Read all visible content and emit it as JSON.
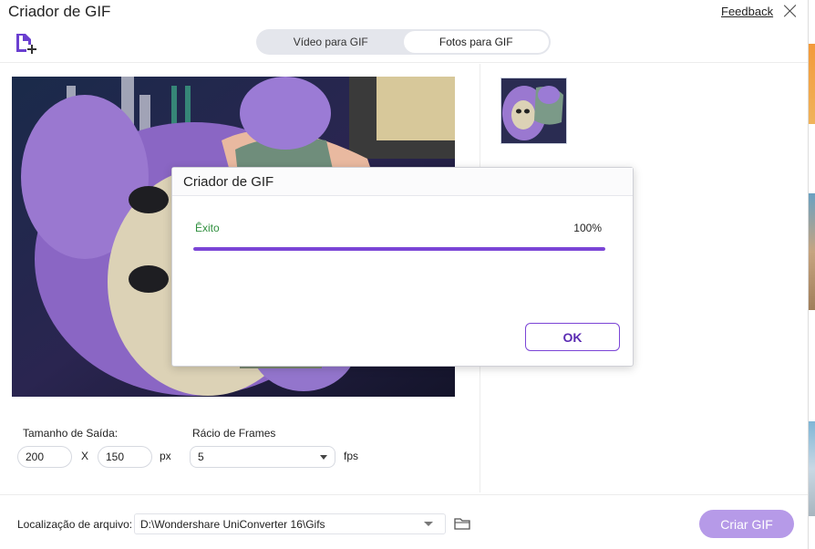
{
  "window": {
    "title": "Criador de GIF",
    "feedback_label": "Feedback"
  },
  "tabs": [
    {
      "label": "Vídeo para GIF",
      "active": false
    },
    {
      "label": "Fotos para GIF",
      "active": true
    }
  ],
  "preview": {
    "image": "purple-plush-toy-photo"
  },
  "settings": {
    "output_size_label": "Tamanho de Saída:",
    "width": "200",
    "separator": "X",
    "height": "150",
    "unit": "px",
    "frame_rate_label": "Rácio de Frames",
    "frame_rate_value": "5",
    "frame_rate_unit": "fps"
  },
  "footer": {
    "location_label": "Localização de arquivo:",
    "location_path": "D:\\Wondershare UniConverter 16\\Gifs",
    "create_label": "Criar GIF"
  },
  "dialog": {
    "title": "Criador de GIF",
    "status": "Êxito",
    "percent_label": "100%",
    "progress": 1.0,
    "ok_label": "OK"
  },
  "colors": {
    "accent": "#7b45d6",
    "create_button": "#b69ae8",
    "success": "#2f8f3e"
  },
  "icons": [
    "add-file-icon",
    "close-icon",
    "folder-icon",
    "chevron-down-icon"
  ]
}
